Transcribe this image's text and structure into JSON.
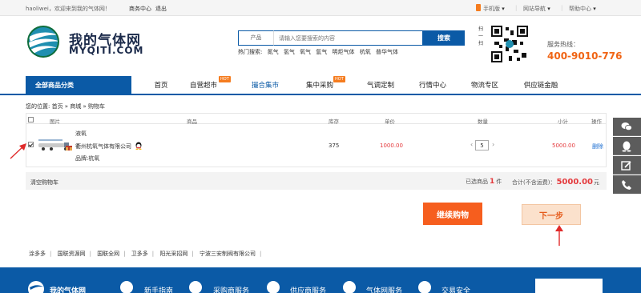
{
  "topbar": {
    "greeting": "haoliwei，欢迎来到我的气体网！",
    "merchant_center": "商务中心",
    "logout": "退出",
    "mobile": "手机版",
    "site_nav": "网站导航",
    "help": "帮助中心"
  },
  "logo": {
    "cn": "我的气体网",
    "en": "MYQITI.COM"
  },
  "search": {
    "category": "产品",
    "placeholder": "请输入您要搜索的内容",
    "button": "搜索",
    "hot_label": "热门搜索:",
    "hot_keywords": [
      "氮气",
      "氢气",
      "氧气",
      "氩气",
      "明炬气体",
      "杭氧",
      "普华气体"
    ]
  },
  "header": {
    "hotline_label": "服务热线：",
    "hotline": "400-9010-776",
    "qr_label": "扫一扫"
  },
  "nav": {
    "category": "全部商品分类",
    "items": [
      "首页",
      "自营超市",
      "撮合集市",
      "集中采购",
      "气调定制",
      "行情中心",
      "物流专区",
      "供应链金融"
    ],
    "hot_badge": "HOT"
  },
  "breadcrumb": "您的位置: 首页 » 商城 » 购物车",
  "table": {
    "headers": {
      "image": "图片",
      "product": "商品",
      "stock": "库存",
      "price": "单价",
      "qty": "数量",
      "subtotal": "小计",
      "action": "操作"
    },
    "row": {
      "name": "液氧",
      "company": "衢州杭氧气体有限公司",
      "brand": "品牌:杭氧",
      "stock": "375",
      "price": "1000.00",
      "qty": "5",
      "subtotal": "5000.00",
      "delete": "删除",
      "checked": true
    }
  },
  "summary": {
    "clear": "清空购物车",
    "selected_prefix": "已选商品",
    "selected_count": "1",
    "selected_suffix": "件",
    "total_prefix": "合计(不含运费)：",
    "total": "5000.00",
    "total_unit": "元"
  },
  "buttons": {
    "continue": "继续购物",
    "next": "下一步"
  },
  "links": [
    "涂多多",
    "国联资源网",
    "国联全网",
    "卫多多",
    "阳光采招网",
    "宁波三安制阀有限公司"
  ],
  "footer": {
    "logo": "我的气体网",
    "items": [
      "新手指南",
      "采购商服务",
      "供应商服务",
      "气体网服务",
      "交易安全"
    ]
  },
  "colors": {
    "brand_blue": "#0b5aa6",
    "accent_orange": "#f65e1e",
    "price_red": "#e4393c"
  }
}
